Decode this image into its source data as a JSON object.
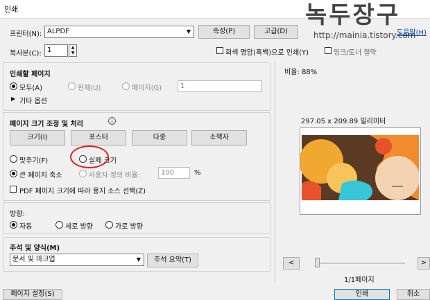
{
  "window": {
    "title": "인쇄"
  },
  "watermark": {
    "title": "녹두장구",
    "url": "http://mainia.tistory.com"
  },
  "printer": {
    "label": "프린터(N):",
    "value": "ALPDF",
    "properties_button": "속성(P)",
    "advanced_button": "고급(D)",
    "help_link": "도움말(H)"
  },
  "copies": {
    "label": "복사본(C):",
    "value": "1"
  },
  "grayscale": {
    "label": "회색 명암(흑백)으로 인쇄(Y)",
    "checked": false
  },
  "save_ink": {
    "label": "잉크/토너 절약",
    "checked": false
  },
  "pages_section": {
    "title": "인쇄할 페이지",
    "all": "모두(A)",
    "current": "현재(U)",
    "pages": "페이지(G)",
    "pages_value": "1",
    "more_options": "기타 옵션"
  },
  "sizing_section": {
    "title": "페이지 크기 조정 및 처리",
    "tabs": [
      "크기(I)",
      "포스터",
      "다중",
      "소책자"
    ],
    "fit": "맞추기(F)",
    "actual_size": "실제 크기",
    "shrink": "큰 페이지 축소",
    "custom_scale": "사용자 정의 비율:",
    "custom_scale_value": "100",
    "percent": "%",
    "paper_source": "PDF 페이지 크기에 따라 용지 소스 선택(Z)"
  },
  "orientation_section": {
    "title": "방향:",
    "auto": "자동",
    "portrait": "세로 방향",
    "landscape": "가로 방향"
  },
  "comments_section": {
    "title": "주석 및 양식(M)",
    "value": "문서 및 마크업",
    "summarize_button": "주석 요약(T)"
  },
  "preview": {
    "scale": "비율: 88%",
    "dimensions": "297.05 x 209.89 밀리미터",
    "page_indicator": "1/1페이지",
    "prev": "<",
    "next": ">"
  },
  "bottom": {
    "page_setup": "페이지 설정(S)",
    "print": "인쇄",
    "cancel": "취소"
  },
  "colors": {
    "accent_red": "#e02020"
  }
}
